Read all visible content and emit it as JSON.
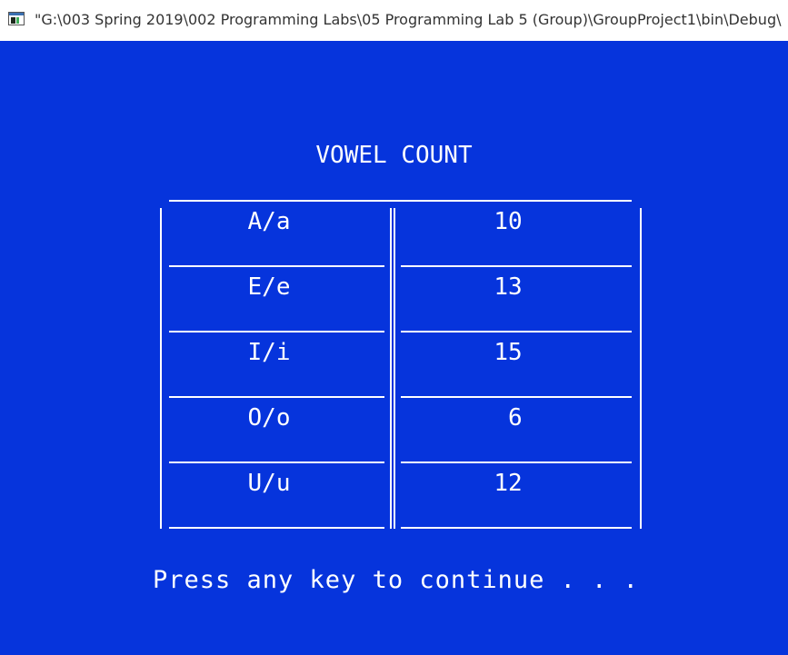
{
  "window": {
    "title": "\"G:\\003 Spring 2019\\002 Programming Labs\\05 Programming Lab 5 (Group)\\GroupProject1\\bin\\Debug\\"
  },
  "console": {
    "heading": "VOWEL COUNT",
    "rows": [
      {
        "vowel": "A/a",
        "count": "10"
      },
      {
        "vowel": "E/e",
        "count": "13"
      },
      {
        "vowel": "I/i",
        "count": "15"
      },
      {
        "vowel": "O/o",
        "count": "6"
      },
      {
        "vowel": "U/u",
        "count": "12"
      }
    ],
    "prompt": "Press any key to continue . . ."
  },
  "colors": {
    "console_background": "#0634DC",
    "console_text": "#FFFFFF",
    "titlebar_background": "#FFFFFF"
  }
}
